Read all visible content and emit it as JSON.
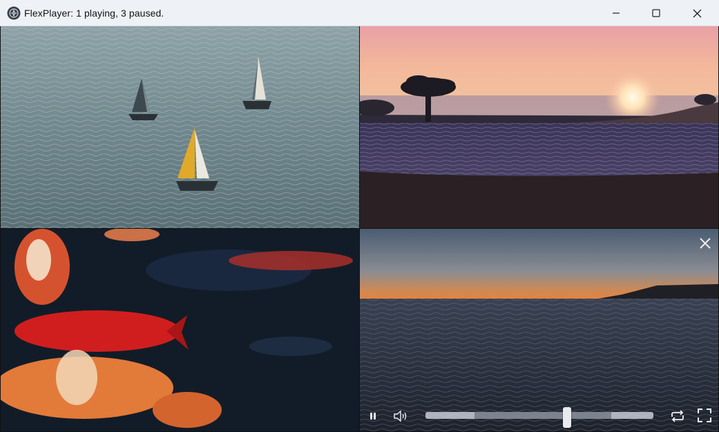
{
  "window": {
    "title": "FlexPlayer: 1 playing, 3 paused.",
    "app_icon": "flexplayer-icon",
    "controls": [
      "minimize-icon",
      "maximize-icon",
      "close-icon"
    ]
  },
  "tiles": [
    {
      "scene": "sailboats-on-water",
      "state": "paused"
    },
    {
      "scene": "sunset-lake-with-tree",
      "state": "paused"
    },
    {
      "scene": "koi-fish",
      "state": "paused"
    },
    {
      "scene": "sea-at-dusk",
      "state": "playing"
    }
  ],
  "active_player": {
    "icons": {
      "close": "close-icon",
      "pause": "pause-icon",
      "volume": "volume-icon",
      "loop": "loop-icon",
      "fullscreen": "fullscreen-icon"
    },
    "seek": {
      "progress": 0.62,
      "buffered_start": 0.215,
      "buffered_end": 0.815
    }
  }
}
